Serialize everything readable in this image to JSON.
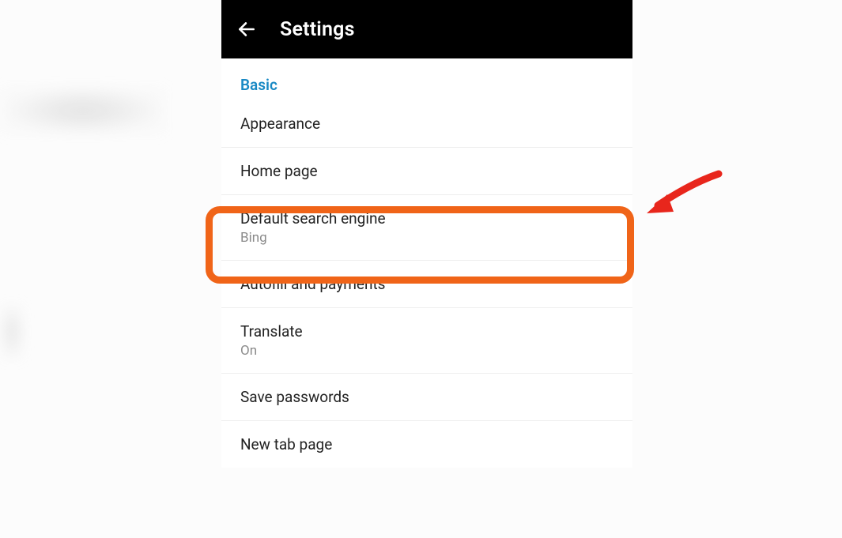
{
  "header": {
    "title": "Settings"
  },
  "section": {
    "label": "Basic"
  },
  "items": {
    "appearance": {
      "title": "Appearance"
    },
    "homepage": {
      "title": "Home page"
    },
    "searchengine": {
      "title": "Default search engine",
      "sub": "Bing"
    },
    "autofill": {
      "title": "Autofill and payments"
    },
    "translate": {
      "title": "Translate",
      "sub": "On"
    },
    "savepasswords": {
      "title": "Save passwords"
    },
    "newtab": {
      "title": "New tab page"
    }
  }
}
